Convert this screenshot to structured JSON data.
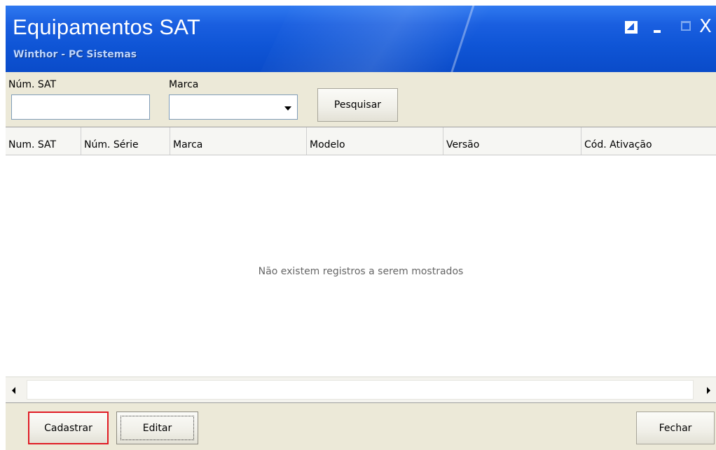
{
  "window": {
    "title": "Equipamentos SAT",
    "subtitle": "Winthor - PC Sistemas",
    "controls": {
      "restore_icon": "restore-icon",
      "minimize_icon": "minimize-icon",
      "maximize_icon": "maximize-icon",
      "close_label": "X"
    },
    "colors": {
      "titlebar": "#1a5fe0",
      "highlight_border": "#e01b24",
      "body": "#ece9d8"
    }
  },
  "filters": {
    "num_sat_label": "Núm. SAT",
    "num_sat_value": "",
    "marca_label": "Marca",
    "marca_value": "",
    "search_label": "Pesquisar"
  },
  "grid": {
    "columns": [
      "Num. SAT",
      "Núm. Série",
      "Marca",
      "Modelo",
      "Versão",
      "Cód. Ativação"
    ],
    "rows": [],
    "empty_message": "Não existem registros a serem mostrados"
  },
  "actions": {
    "add_label": "Cadastrar",
    "edit_label": "Editar",
    "close_label": "Fechar"
  }
}
